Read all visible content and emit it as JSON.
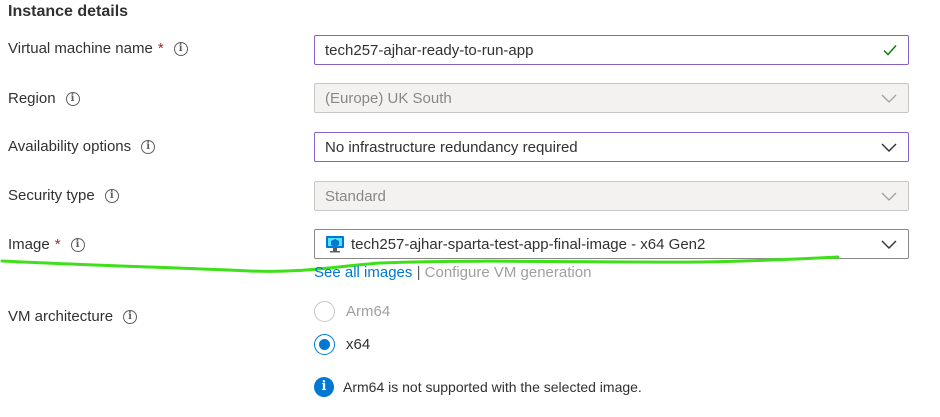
{
  "section": {
    "title": "Instance details"
  },
  "fields": {
    "vm_name": {
      "label": "Virtual machine name",
      "required": "*",
      "value": "tech257-ajhar-ready-to-run-app"
    },
    "region": {
      "label": "Region",
      "value": "(Europe) UK South"
    },
    "availability": {
      "label": "Availability options",
      "value": "No infrastructure redundancy required"
    },
    "security": {
      "label": "Security type",
      "value": "Standard"
    },
    "image": {
      "label": "Image",
      "required": "*",
      "value": "tech257-ajhar-sparta-test-app-final-image - x64 Gen2"
    }
  },
  "image_links": {
    "see_all": "See all images",
    "separator": "|",
    "configure": "Configure VM generation"
  },
  "architecture": {
    "label": "VM architecture",
    "options": [
      {
        "label": "Arm64",
        "selected": false,
        "disabled": true
      },
      {
        "label": "x64",
        "selected": true,
        "disabled": false
      }
    ],
    "note": "Arm64 is not supported with the selected image."
  },
  "colors": {
    "accent": "#0078d4",
    "focus_border": "#8661c5",
    "valid_check": "#107c10",
    "annotation": "#3ee01a",
    "required": "#a4262c"
  }
}
